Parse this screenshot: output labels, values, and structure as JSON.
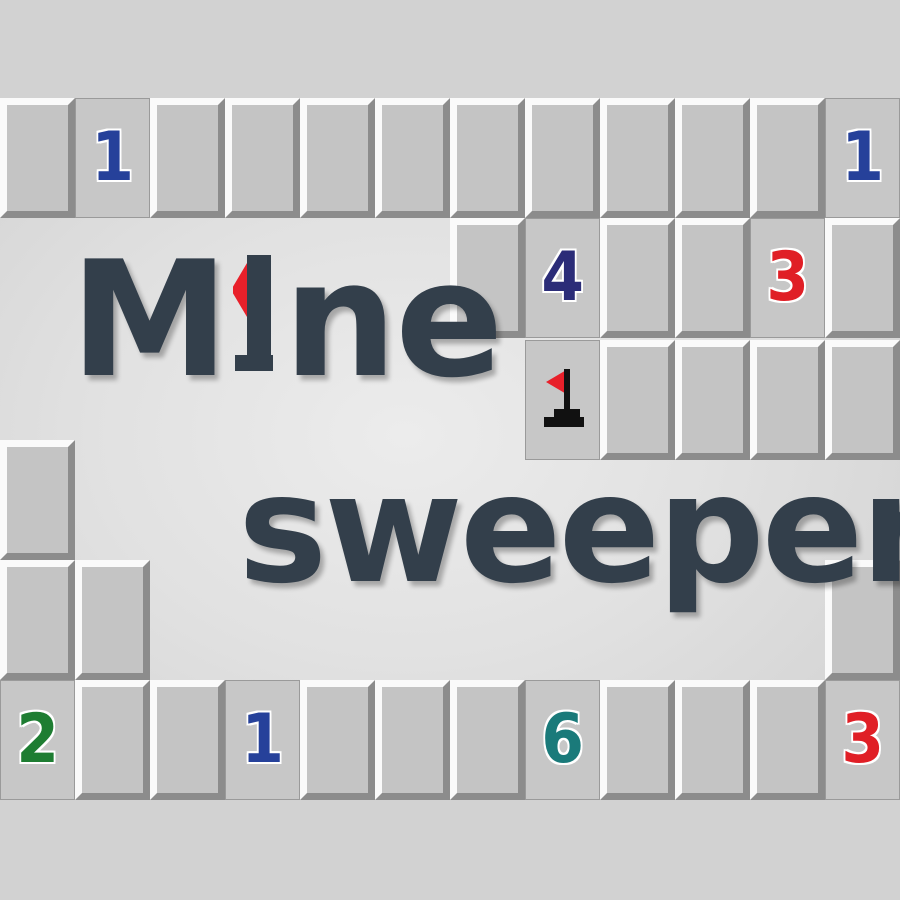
{
  "game": {
    "title_part1": "M",
    "title_part2": "ne",
    "title_line2": "sweeper",
    "flag_icon": "flag-icon",
    "title_i_icon": "flag-i-icon"
  },
  "colors": {
    "one": "#26419a",
    "two": "#1e7d32",
    "three": "#e01f26",
    "four": "#2b2c78",
    "six": "#1a7a7a",
    "title": "#333f4b",
    "flag_red": "#e8202a"
  },
  "cells": [
    {
      "name": "cell-r0-c0",
      "state": "raised"
    },
    {
      "name": "cell-r0-c1",
      "state": "open",
      "value": "1",
      "color": "one"
    },
    {
      "name": "cell-r0-c2",
      "state": "raised"
    },
    {
      "name": "cell-r0-c3",
      "state": "raised"
    },
    {
      "name": "cell-r0-c4",
      "state": "raised"
    },
    {
      "name": "cell-r0-c5",
      "state": "raised"
    },
    {
      "name": "cell-r0-c6",
      "state": "raised"
    },
    {
      "name": "cell-r0-c7",
      "state": "raised"
    },
    {
      "name": "cell-r0-c8",
      "state": "raised"
    },
    {
      "name": "cell-r0-c9",
      "state": "raised"
    },
    {
      "name": "cell-r0-c10",
      "state": "raised"
    },
    {
      "name": "cell-r0-c11",
      "state": "open",
      "value": "1",
      "color": "one"
    },
    {
      "name": "cell-r1-c6",
      "state": "raised"
    },
    {
      "name": "cell-r1-c7",
      "state": "open",
      "value": "4",
      "color": "four"
    },
    {
      "name": "cell-r1-c8",
      "state": "raised"
    },
    {
      "name": "cell-r1-c9",
      "state": "raised"
    },
    {
      "name": "cell-r1-c10",
      "state": "open",
      "value": "3",
      "color": "three"
    },
    {
      "name": "cell-r1-c11",
      "state": "raised"
    },
    {
      "name": "cell-r2-c7",
      "state": "flag"
    },
    {
      "name": "cell-r2-c8",
      "state": "raised"
    },
    {
      "name": "cell-r2-c9",
      "state": "raised"
    },
    {
      "name": "cell-r2-c10",
      "state": "raised"
    },
    {
      "name": "cell-r2-c11",
      "state": "raised"
    },
    {
      "name": "cell-r3-c0",
      "state": "raised"
    },
    {
      "name": "cell-r4-c0",
      "state": "raised"
    },
    {
      "name": "cell-r4-c1",
      "state": "raised"
    },
    {
      "name": "cell-r4-c11",
      "state": "raised"
    },
    {
      "name": "cell-r5-c0",
      "state": "open",
      "value": "2",
      "color": "two"
    },
    {
      "name": "cell-r5-c1",
      "state": "raised"
    },
    {
      "name": "cell-r5-c2",
      "state": "raised"
    },
    {
      "name": "cell-r5-c3",
      "state": "open",
      "value": "1",
      "color": "one"
    },
    {
      "name": "cell-r5-c4",
      "state": "raised"
    },
    {
      "name": "cell-r5-c5",
      "state": "raised"
    },
    {
      "name": "cell-r5-c6",
      "state": "raised"
    },
    {
      "name": "cell-r5-c7",
      "state": "open",
      "value": "6",
      "color": "six"
    },
    {
      "name": "cell-r5-c8",
      "state": "raised"
    },
    {
      "name": "cell-r5-c9",
      "state": "raised"
    },
    {
      "name": "cell-r5-c10",
      "state": "raised"
    },
    {
      "name": "cell-r5-c11",
      "state": "open",
      "value": "3",
      "color": "three"
    }
  ]
}
